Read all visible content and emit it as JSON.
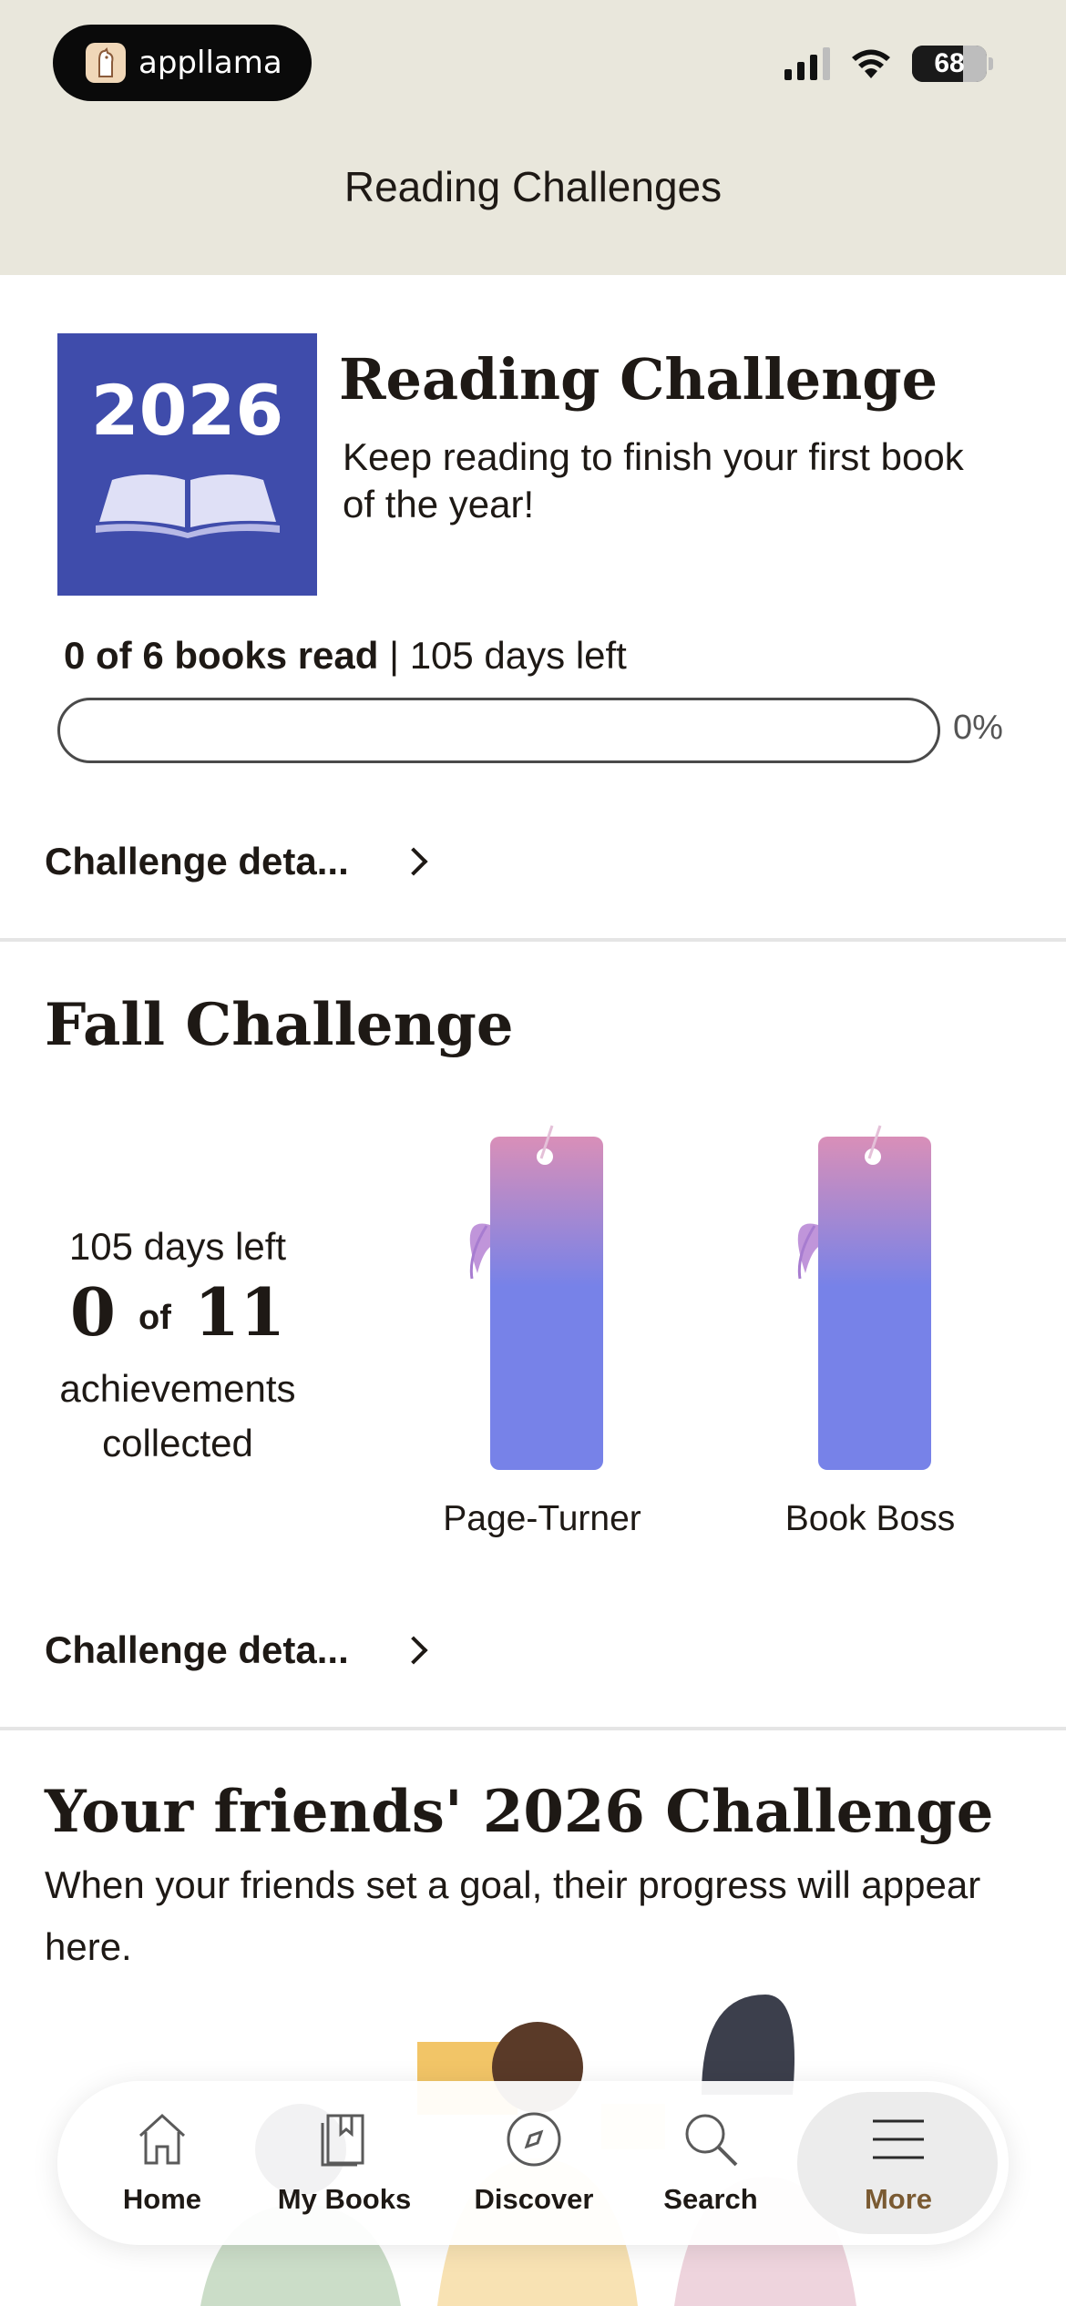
{
  "status_bar": {
    "app_name": "appllama",
    "battery": "68"
  },
  "header": {
    "title": "Reading Challenges"
  },
  "reading_challenge": {
    "cover_year": "2026",
    "title": "Reading Challenge",
    "subtitle": "Keep reading to finish your first book of the year!",
    "books_read": "0 of 6 books read",
    "separator": " | ",
    "days_left": "105 days left",
    "progress_fraction": 0,
    "progress_percent": "0%",
    "details_label": "Challenge deta..."
  },
  "fall_challenge": {
    "title": "Fall Challenge",
    "days_left": "105 days left",
    "count": "0",
    "of": "of",
    "total": "11",
    "achievements_label": "achievements collected",
    "badges": [
      {
        "label": "Page-Turner"
      },
      {
        "label": "Book Boss"
      }
    ],
    "details_label": "Challenge deta..."
  },
  "friends": {
    "title": "Your friends' 2026 Challenge",
    "subtitle": "When your friends set a goal, their progress will appear here."
  },
  "tabbar": {
    "items": [
      {
        "label": "Home",
        "icon": "home-icon"
      },
      {
        "label": "My Books",
        "icon": "bookmark-book-icon"
      },
      {
        "label": "Discover",
        "icon": "compass-icon"
      },
      {
        "label": "Search",
        "icon": "search-icon"
      },
      {
        "label": "More",
        "icon": "menu-icon"
      }
    ],
    "active": "More",
    "active_color": "#7a5a32"
  },
  "colors": {
    "header_bg": "#e9e7dc",
    "cover_bg": "#3f4cab",
    "bookmark_top": "#d98fb8",
    "bookmark_bottom": "#7782e8"
  }
}
